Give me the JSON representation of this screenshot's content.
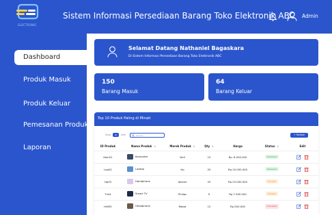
{
  "header": {
    "logo_text": "ELECTRONIC",
    "title": "Sistem Informasi Persediaan Barang Toko Elektronik ABC",
    "admin_label": "Admin"
  },
  "sidebar": {
    "items": [
      {
        "label": "Dashboard",
        "active": true
      },
      {
        "label": "Produk Masuk",
        "active": false
      },
      {
        "label": "Produk Keluar",
        "active": false
      },
      {
        "label": "Pemesanan Produk",
        "active": false
      },
      {
        "label": "Laporan",
        "active": false
      }
    ]
  },
  "welcome": {
    "title": "Selamat Datang Nathaniel Bagaskara",
    "subtitle": "Di Sistem Informasi Persediaan Barang Toko Elektronik ABC"
  },
  "stats": [
    {
      "value": "150",
      "label": "Barang Masuk"
    },
    {
      "value": "64",
      "label": "Barang Keluar"
    }
  ],
  "top_products": {
    "title": "Top 10 Produk Paling di Minati",
    "show_label": "Show",
    "show_value": "10",
    "entries_label": "entri",
    "search_placeholder": "Search...",
    "add_button": "+ Tambah",
    "columns": [
      "ID Produk",
      "Nama Produk",
      "Merek Produk",
      "Qty",
      "Harga",
      "Status",
      "Edit"
    ],
    "rows": [
      {
        "id": "Kom01",
        "name": "Komputer",
        "brand": "Dell",
        "qty": "15",
        "price": "Rp. 8.500.000",
        "status": "Delivered",
        "thumb_color": "#3a4a6a"
      },
      {
        "id": "Lap02",
        "name": "Laptop",
        "brand": "Hp",
        "qty": "20",
        "price": "Rp.10.000.000",
        "status": "Delivered",
        "thumb_color": "#5a8fd0"
      },
      {
        "id": "Hp03",
        "name": "Handphone",
        "brand": "Iphone",
        "qty": "25",
        "price": "Rp.23.000.000",
        "status": "Process",
        "thumb_color": "#d9c9e8"
      },
      {
        "id": "Tv04",
        "name": "Smart TV",
        "brand": "Philips",
        "qty": "9",
        "price": "Rp.7.500.000",
        "status": "Process",
        "thumb_color": "#1f2a44"
      },
      {
        "id": "Hdf05",
        "name": "Headphone",
        "brand": "Robot",
        "qty": "12",
        "price": "Rp.500.000",
        "status": "Canceled",
        "thumb_color": "#6b5a4a"
      }
    ],
    "status_colors": {
      "Delivered": {
        "bg": "#dff5e7",
        "fg": "#2e9e57"
      },
      "Process": {
        "bg": "#fdeeda",
        "fg": "#e08a1e"
      },
      "Canceled": {
        "bg": "#fde2e2",
        "fg": "#d93a3a"
      }
    }
  },
  "colors": {
    "primary": "#2b55cc",
    "edit_icon": "#2b55cc",
    "delete_icon": "#d93a3a"
  }
}
